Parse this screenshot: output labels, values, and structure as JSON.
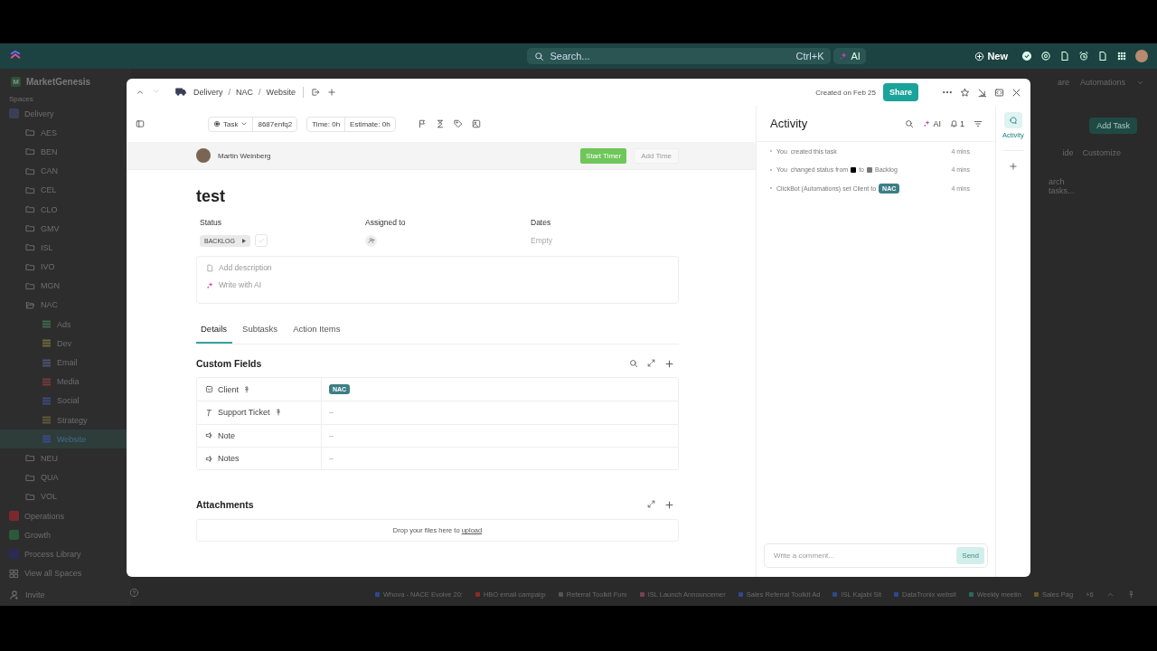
{
  "topbar": {
    "search_placeholder": "Search...",
    "shortcut": "Ctrl+K",
    "ai": "AI",
    "new": "New"
  },
  "workspace": {
    "initial": "M",
    "name": "MarketGenesis"
  },
  "sidebar": {
    "spaces_label": "Spaces",
    "tree": [
      {
        "kind": "space",
        "label": "Delivery",
        "color": "#3a3f58",
        "selected": false,
        "children": [
          {
            "kind": "folder",
            "label": "AES",
            "selected": false,
            "expanded": false
          },
          {
            "kind": "folder",
            "label": "BEN",
            "selected": false,
            "expanded": false
          },
          {
            "kind": "folder",
            "label": "CAN",
            "selected": false,
            "expanded": false
          },
          {
            "kind": "folder",
            "label": "CEL",
            "selected": false,
            "expanded": false
          },
          {
            "kind": "folder",
            "label": "CLO",
            "selected": false,
            "expanded": false
          },
          {
            "kind": "folder",
            "label": "GMV",
            "selected": false,
            "expanded": false
          },
          {
            "kind": "folder",
            "label": "ISL",
            "selected": false,
            "expanded": false
          },
          {
            "kind": "folder",
            "label": "IVO",
            "selected": false,
            "expanded": false
          },
          {
            "kind": "folder",
            "label": "MGN",
            "selected": false,
            "expanded": false
          },
          {
            "kind": "folder",
            "label": "NAC",
            "selected": false,
            "expanded": true,
            "children": [
              {
                "kind": "list",
                "label": "Ads",
                "color": "#3d6b4a",
                "selected": false
              },
              {
                "kind": "list",
                "label": "Dev",
                "color": "#6b6a3a",
                "selected": false
              },
              {
                "kind": "list",
                "label": "Email",
                "color": "#4a5570",
                "selected": false
              },
              {
                "kind": "list",
                "label": "Media",
                "color": "#7a3a3a",
                "selected": false
              },
              {
                "kind": "list",
                "label": "Social",
                "color": "#3f4a7a",
                "selected": false
              },
              {
                "kind": "list",
                "label": "Strategy",
                "color": "#5f5a3a",
                "selected": false
              },
              {
                "kind": "list",
                "label": "Website",
                "color": "#3a4a8a",
                "selected": true
              }
            ]
          },
          {
            "kind": "folder",
            "label": "NEU",
            "selected": false,
            "expanded": false
          },
          {
            "kind": "folder",
            "label": "QUA",
            "selected": false,
            "expanded": false
          },
          {
            "kind": "folder",
            "label": "VOL",
            "selected": false,
            "expanded": false
          }
        ]
      },
      {
        "kind": "space",
        "label": "Operations",
        "color": "#7a2a2a",
        "selected": false
      },
      {
        "kind": "space",
        "label": "Growth",
        "color": "#2a5a3a",
        "selected": false
      },
      {
        "kind": "space",
        "label": "Process Library",
        "color": "#2a2a55",
        "selected": false
      }
    ],
    "view_all": "View all Spaces",
    "invite": "Invite"
  },
  "background": {
    "share_fragment": "are",
    "automations": "Automations",
    "add_task": "Add Task",
    "hide_fragment": "ide",
    "customize": "Customize",
    "search_fragment": "arch tasks..."
  },
  "taskbar": {
    "items": [
      {
        "label": "Whova - NACE Evolve 20:",
        "color": "#2d4a8a"
      },
      {
        "label": "HBO email campaigı",
        "color": "#8a2a2a"
      },
      {
        "label": "Referral Toolkit Funı",
        "color": "#555555"
      },
      {
        "label": "ISL Launch Announcemer",
        "color": "#7a3f55"
      },
      {
        "label": "Sales Referral Toolkit Ad",
        "color": "#2d4a8a"
      },
      {
        "label": "ISL Kajabi Sit",
        "color": "#2d4a8a"
      },
      {
        "label": "DataTronix websit",
        "color": "#2d4a8a"
      },
      {
        "label": "Weekly meetin",
        "color": "#2a6a5a"
      },
      {
        "label": "Sales Pag",
        "color": "#6a5a2a"
      }
    ],
    "more": "+6"
  },
  "modal": {
    "breadcrumb": [
      "Delivery",
      "NAC",
      "Website"
    ],
    "breadcrumb_separators": [
      "/",
      "/"
    ],
    "created": "Created on Feb 25",
    "share": "Share",
    "task_type": "Task",
    "task_id": "8687enfq2",
    "time": "Time: 0h",
    "estimate": "Estimate: 0h",
    "owner": "Martin Weinberg",
    "start_timer": "Start Timer",
    "add_time": "Add Time",
    "title": "test",
    "status": {
      "label": "Status",
      "value": "BACKLOG",
      "complete": false
    },
    "assigned": {
      "label": "Assigned to"
    },
    "dates": {
      "label": "Dates",
      "placeholder": "Empty"
    },
    "description_placeholder": "Add description",
    "write_ai": "Write with AI",
    "tabs": [
      {
        "label": "Details",
        "selected": true
      },
      {
        "label": "Subtasks",
        "selected": false
      },
      {
        "label": "Action Items",
        "selected": false
      }
    ],
    "custom_fields": {
      "title": "Custom Fields",
      "rows": [
        {
          "kind": "dropdown",
          "name": "Client",
          "pinned": true,
          "value": "NAC"
        },
        {
          "kind": "text",
          "name": "Support Ticket",
          "pinned": true,
          "value": "–"
        },
        {
          "kind": "textarea",
          "name": "Note",
          "pinned": false,
          "value": "–"
        },
        {
          "kind": "textarea",
          "name": "Notes",
          "pinned": false,
          "value": "–"
        }
      ]
    },
    "attachments": {
      "title": "Attachments",
      "drop_text": "Drop your files here to",
      "upload": "upload"
    }
  },
  "activity": {
    "title": "Activity",
    "ai": "AI",
    "notifications": "1",
    "items": [
      {
        "kind": "plain",
        "actor": "You",
        "text": "created this task",
        "time": "4 mins"
      },
      {
        "kind": "status",
        "actor": "You",
        "text": "changed status from",
        "from": {
          "color": "#000000"
        },
        "joiner": "to",
        "to": {
          "color": "#777777",
          "label": "Backlog"
        },
        "time": "4 mins"
      },
      {
        "kind": "tag",
        "actor": "ClickBot (Automations)",
        "text": "set Client to",
        "tag": "NAC",
        "time": "4 mins"
      }
    ],
    "comment_placeholder": "Write a comment...",
    "send": "Send",
    "rail_label": "Activity"
  }
}
